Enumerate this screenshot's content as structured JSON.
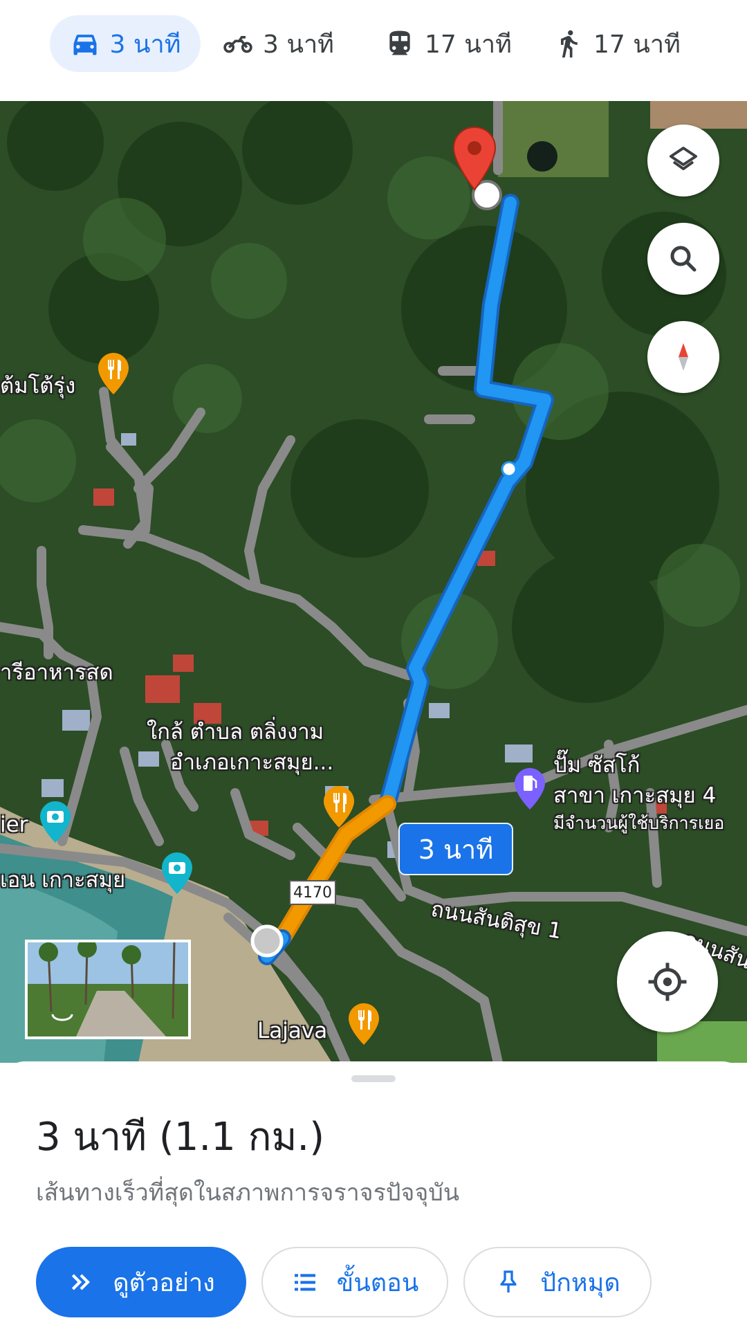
{
  "modes": [
    {
      "icon": "car-icon",
      "label": "3 นาที",
      "active": true
    },
    {
      "icon": "motorcycle-icon",
      "label": "3 นาที",
      "active": false
    },
    {
      "icon": "transit-icon",
      "label": "17 นาที",
      "active": false
    },
    {
      "icon": "walk-icon",
      "label": "17 นาที",
      "active": false
    }
  ],
  "map": {
    "labels": {
      "restaurant_tomtorung": "ต้มโต้รุ่ง",
      "seafood": "ารีอาหารสด",
      "near_area_line1": "ใกล้ ตำบล ตลิ่งงาม",
      "near_area_line2": "อำเภอเกาะสมุย...",
      "pier": "ier",
      "samui": "เอน เกาะสมุย",
      "gas_line1": "ปั๊ม ซัสโก้",
      "gas_line2": "สาขา เกาะสมุย 4",
      "gas_line3": "มีจำนวนผู้ใช้บริการเยอ",
      "road_santisuk": "ถนนสันติสุข 1",
      "road_right": "ถนนสัน",
      "lajava": "Lajava"
    },
    "route_number": "4170",
    "duration_chip": "3 นาที",
    "colors": {
      "route": "#2196f3",
      "route_traffic": "#f29900",
      "pin": "#ea4335",
      "poi_food": "#f29900",
      "poi_photo": "#12b5cb",
      "poi_gas": "#7b61ff"
    }
  },
  "sheet": {
    "title": "3 นาที (1.1 กม.)",
    "subtitle": "เส้นทางเร็วที่สุดในสภาพการจราจรปัจจุบัน",
    "buttons": {
      "preview": "ดูตัวอย่าง",
      "steps": "ขั้นตอน",
      "pin": "ปักหมุด"
    }
  }
}
